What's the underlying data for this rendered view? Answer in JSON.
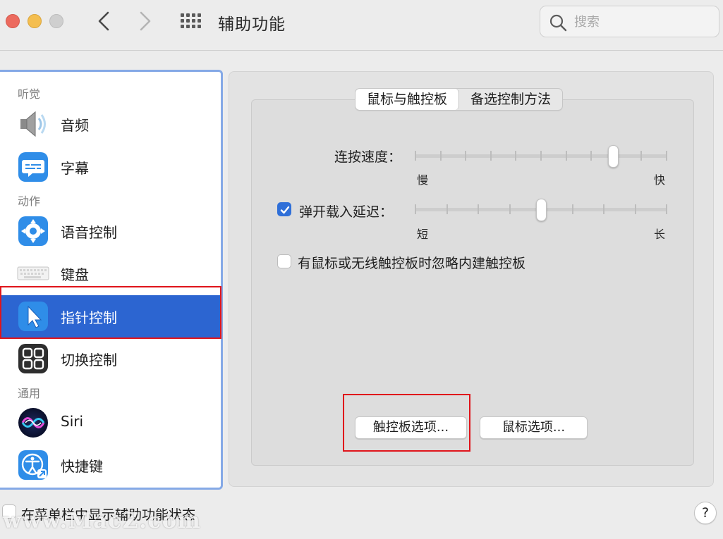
{
  "window": {
    "title": "辅助功能",
    "search_placeholder": "搜索"
  },
  "sidebar": {
    "sections": [
      {
        "header": "听觉",
        "items": [
          {
            "label": "音频",
            "icon": "speaker-icon"
          },
          {
            "label": "字幕",
            "icon": "captions-icon"
          }
        ]
      },
      {
        "header": "动作",
        "items": [
          {
            "label": "语音控制",
            "icon": "voice-control-icon"
          },
          {
            "label": "键盘",
            "icon": "keyboard-icon"
          },
          {
            "label": "指针控制",
            "icon": "pointer-icon",
            "selected": true
          },
          {
            "label": "切换控制",
            "icon": "switch-control-icon"
          }
        ]
      },
      {
        "header": "通用",
        "items": [
          {
            "label": "Siri",
            "icon": "siri-icon"
          },
          {
            "label": "快捷键",
            "icon": "accessibility-shortcut-icon"
          }
        ]
      }
    ]
  },
  "tabs": [
    {
      "label": "鼠标与触控板",
      "active": true
    },
    {
      "label": "备选控制方法",
      "active": false
    }
  ],
  "settings": {
    "double_click_speed": {
      "label": "连按速度：",
      "min_label": "慢",
      "max_label": "快",
      "value_fraction": 0.8,
      "ticks": 11
    },
    "spring_loading": {
      "label": "弹开载入延迟：",
      "checked": true,
      "min_label": "短",
      "max_label": "长",
      "value_fraction": 0.5,
      "ticks": 9
    },
    "ignore_builtin": {
      "label": "有鼠标或无线触控板时忽略内建触控板",
      "checked": false
    }
  },
  "buttons": {
    "trackpad_options": "触控板选项...",
    "mouse_options": "鼠标选项..."
  },
  "footer": {
    "menubar_status_label": "在菜单栏中显示辅助功能状态",
    "menubar_status_checked": false,
    "help_label": "?"
  },
  "watermark": "www.MacZ.com",
  "colors": {
    "accent": "#2c65d1",
    "checkbox_checked": "#2f6fd8",
    "highlight_frame": "#e0141b"
  }
}
